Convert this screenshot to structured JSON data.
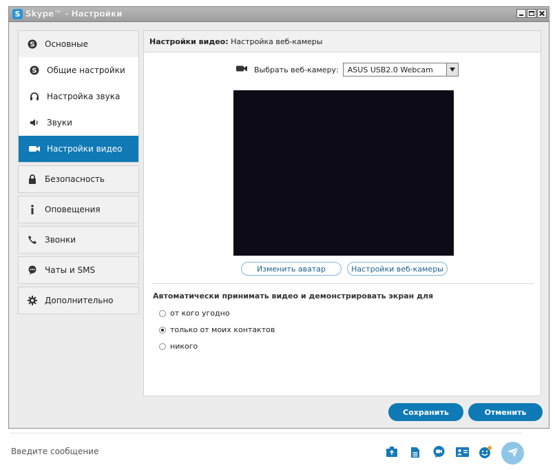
{
  "window": {
    "logo_letter": "S",
    "title": "Skype™ - Настройки"
  },
  "sidebar": {
    "groups": [
      {
        "label": "Основные",
        "icon": "skype-icon",
        "subitems": [
          {
            "label": "Общие настройки",
            "icon": "skype-icon"
          },
          {
            "label": "Настройка звука",
            "icon": "headset-icon"
          },
          {
            "label": "Звуки",
            "icon": "speaker-icon"
          },
          {
            "label": "Настройки видео",
            "icon": "video-camera-icon",
            "selected": true
          }
        ]
      },
      {
        "label": "Безопасность",
        "icon": "lock-icon"
      },
      {
        "label": "Оповещения",
        "icon": "info-icon"
      },
      {
        "label": "Звонки",
        "icon": "phone-icon"
      },
      {
        "label": "Чаты и SMS",
        "icon": "chat-icon"
      },
      {
        "label": "Дополнительно",
        "icon": "gear-icon"
      }
    ]
  },
  "content": {
    "header_bold": "Настройки видео:",
    "header_rest": " Настройка веб-камеры",
    "webcam_label": "Выбрать веб-камеру:",
    "webcam_value": "ASUS USB2.0 Webcam",
    "change_avatar": "Изменить аватар",
    "webcam_settings": "Настройки веб-камеры",
    "auto_accept_title": "Автоматически принимать видео и демонстрировать экран для",
    "radio_options": [
      {
        "label": "от кого угодно",
        "checked": false
      },
      {
        "label": "только от моих контактов",
        "checked": true
      },
      {
        "label": "никого",
        "checked": false
      }
    ]
  },
  "buttons": {
    "save": "Сохранить",
    "cancel": "Отменить"
  },
  "message_bar": {
    "placeholder": "Введите сообщение"
  },
  "colors": {
    "accent": "#0f7ab5",
    "video_bg": "#0d0b16"
  }
}
